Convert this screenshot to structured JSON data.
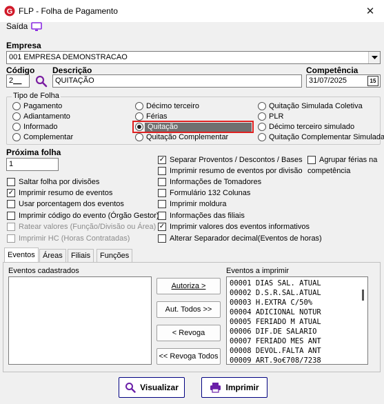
{
  "window": {
    "title": "FLP - Folha de Pagamento",
    "close_glyph": "✕"
  },
  "menu": {
    "saida_label": "Saída",
    "monitor_icon": "monitor-icon"
  },
  "empresa": {
    "label": "Empresa",
    "value": "001 EMPRESA DEMONSTRACAO"
  },
  "codigo": {
    "label": "Código",
    "value": "2"
  },
  "descricao": {
    "label": "Descrição",
    "value": "QUITAÇÃO"
  },
  "competencia": {
    "label": "Competência",
    "value": "31/07/2025",
    "calendar_day": "15"
  },
  "tipo_folha": {
    "title": "Tipo de Folha",
    "options": [
      [
        "Pagamento",
        "Adiantamento",
        "Informado",
        "Complementar"
      ],
      [
        "Décimo terceiro",
        "Férias",
        "Quitação",
        "Quitação Complementar"
      ],
      [
        "Quitação Simulada Coletiva",
        "PLR",
        "Décimo terceiro simulado",
        "Quitação Complementar Simulada"
      ]
    ],
    "selected": "Quitação",
    "highlight_color": "#e02020"
  },
  "proxima_folha": {
    "label": "Próxima folha",
    "value": "1"
  },
  "options_left": [
    {
      "label": "Saltar folha por divisões",
      "checked": false,
      "disabled": false
    },
    {
      "label": "Imprimir resumo de eventos",
      "checked": true,
      "disabled": false
    },
    {
      "label": "Usar porcentagem dos eventos",
      "checked": false,
      "disabled": false
    },
    {
      "label": "Imprimir código do evento (Órgão Gestor)",
      "checked": false,
      "disabled": false
    },
    {
      "label": "Ratear valores (Função/Divisão ou Área)",
      "checked": false,
      "disabled": true
    },
    {
      "label": "Imprimir HC (Horas Contratadas)",
      "checked": false,
      "disabled": true
    }
  ],
  "options_mid": [
    {
      "label": "Separar Proventos / Descontos / Bases",
      "checked": true
    },
    {
      "label": "Imprimir resumo de eventos por divisão",
      "checked": false
    },
    {
      "label": "Informações de Tomadores",
      "checked": false
    },
    {
      "label": "Formulário 132 Colunas",
      "checked": false
    },
    {
      "label": "Imprimir moldura",
      "checked": false
    },
    {
      "label": "Informações das filiais",
      "checked": false
    },
    {
      "label": "Imprimir valores dos eventos informativos",
      "checked": true
    },
    {
      "label": "Alterar Separador decimal(Eventos de horas)",
      "checked": false
    }
  ],
  "agrupar": {
    "line1": "Agrupar férias na",
    "line2": "competência",
    "checked": false
  },
  "tabs": [
    "Eventos",
    "Áreas",
    "Filiais",
    "Funções"
  ],
  "eventos": {
    "cadastrados_label": "Eventos cadastrados",
    "imprimir_label": "Eventos a imprimir",
    "imprimir_items": [
      "00001 DIAS SAL. ATUAL",
      "00002 D.S.R.SAL.ATUAL",
      "00003 H.EXTRA C/50%",
      "00004 ADICIONAL NOTUR",
      "00005 FERIADO M ATUAL",
      "00006 DIF.DE SALARIO",
      "00007 FERIADO MES ANT",
      "00008 DEVOL.FALTA ANT",
      "00009 ART.9o€708/7238"
    ],
    "buttons": [
      "Autoriza >",
      "Aut. Todos >>",
      "< Revoga",
      "<< Revoga Todos"
    ]
  },
  "footer": {
    "visualizar": "Visualizar",
    "imprimir": "Imprimir",
    "accent": "#6a1fa8"
  }
}
